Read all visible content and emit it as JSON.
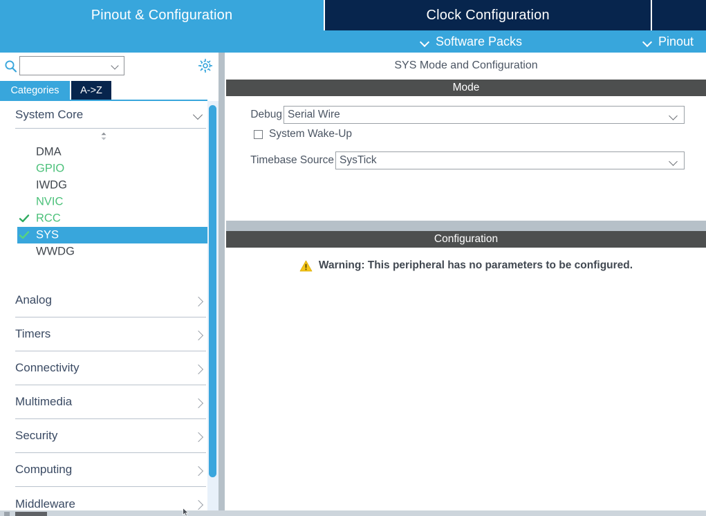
{
  "app": {
    "tabs": [
      {
        "label": "Pinout & Configuration",
        "active": true
      },
      {
        "label": "Clock Configuration",
        "active": false
      },
      {
        "label": "",
        "active": false
      }
    ],
    "subbar": {
      "software_packs": "Software Packs",
      "pinout": "Pinout",
      "chevron_icon": "chevron-down-icon"
    }
  },
  "sidebar": {
    "search": {
      "value": "",
      "placeholder": "",
      "icon": "search-icon",
      "dropdown_icon": "chevron-down-icon"
    },
    "settings_icon": "gear-icon",
    "subtabs": [
      {
        "label": "Categories",
        "active": true
      },
      {
        "label": "A->Z",
        "active": false
      }
    ],
    "spinner_icon": "up-down-spinner-icon",
    "open_category": {
      "label": "System Core",
      "expanded": true,
      "chevron_icon": "chevron-down-icon",
      "peripherals": [
        {
          "name": "DMA",
          "configured": false,
          "enabled": false
        },
        {
          "name": "GPIO",
          "configured": false,
          "enabled": true
        },
        {
          "name": "IWDG",
          "configured": false,
          "enabled": false
        },
        {
          "name": "NVIC",
          "configured": false,
          "enabled": true
        },
        {
          "name": "RCC",
          "configured": true,
          "enabled": true
        },
        {
          "name": "SYS",
          "configured": true,
          "enabled": true,
          "selected": true
        },
        {
          "name": "WWDG",
          "configured": false,
          "enabled": false
        }
      ]
    },
    "categories": [
      {
        "label": "Analog",
        "chevron_icon": "chevron-right-icon"
      },
      {
        "label": "Timers",
        "chevron_icon": "chevron-right-icon"
      },
      {
        "label": "Connectivity",
        "chevron_icon": "chevron-right-icon"
      },
      {
        "label": "Multimedia",
        "chevron_icon": "chevron-right-icon"
      },
      {
        "label": "Security",
        "chevron_icon": "chevron-right-icon"
      },
      {
        "label": "Computing",
        "chevron_icon": "chevron-right-icon"
      },
      {
        "label": "Middleware",
        "chevron_icon": "chevron-right-icon"
      }
    ],
    "scrollbar": {
      "orientation": "vertical"
    }
  },
  "main": {
    "title": "SYS Mode and Configuration",
    "mode": {
      "header": "Mode",
      "debug": {
        "label": "Debug",
        "value": "Serial Wire",
        "chevron_icon": "chevron-down-icon"
      },
      "system_wake_up": {
        "label": "System Wake-Up",
        "checked": false
      },
      "timebase_source": {
        "label": "Timebase Source",
        "value": "SysTick",
        "chevron_icon": "chevron-down-icon"
      }
    },
    "configuration": {
      "header": "Configuration",
      "warning_icon": "warning-triangle-icon",
      "warning_text": "Warning: This peripheral has no parameters to be configured."
    }
  },
  "colors": {
    "accent_blue": "#38a6dc",
    "dark_navy": "#07254d",
    "header_gray": "#4d4f4f",
    "green": "#4cc17a",
    "warning_yellow": "#f4c420",
    "frame_gray": "#b6c0c8"
  }
}
